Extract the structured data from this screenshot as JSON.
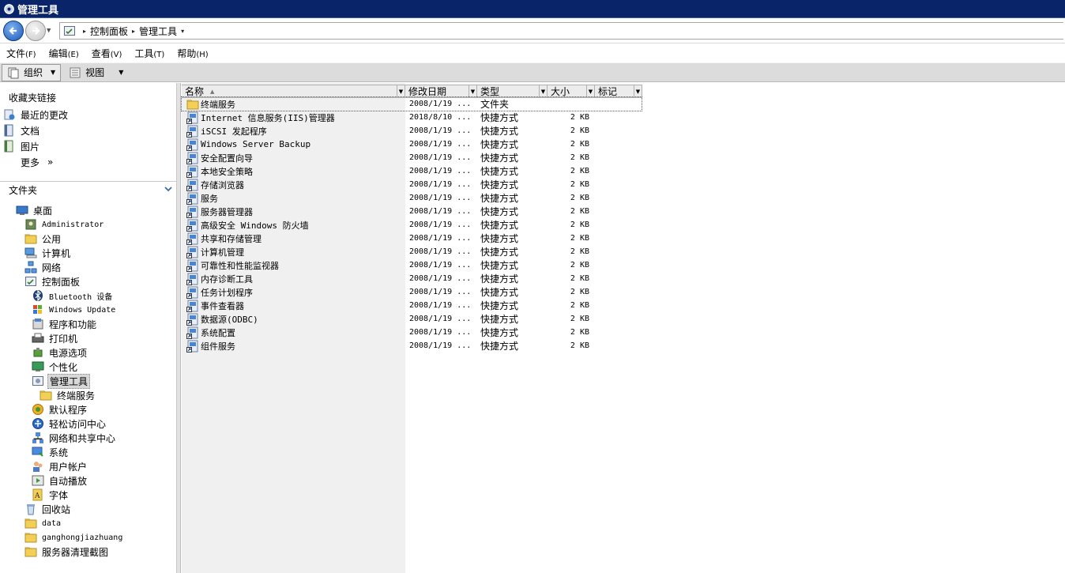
{
  "window": {
    "title": "管理工具"
  },
  "address": {
    "crumbs": [
      "控制面板",
      "管理工具"
    ]
  },
  "menu": [
    {
      "label": "文件",
      "key": "(F)"
    },
    {
      "label": "编辑",
      "key": "(E)"
    },
    {
      "label": "查看",
      "key": "(V)"
    },
    {
      "label": "工具",
      "key": "(T)"
    },
    {
      "label": "帮助",
      "key": "(H)"
    }
  ],
  "toolbar": {
    "organize": "组织",
    "views": "视图"
  },
  "favorites": {
    "header": "收藏夹链接",
    "items": [
      {
        "label": "最近的更改",
        "icon": "recent-icon"
      },
      {
        "label": "文档",
        "icon": "documents-icon"
      },
      {
        "label": "图片",
        "icon": "pictures-icon"
      },
      {
        "label": "更多",
        "icon": "more-icon",
        "suffix": "»"
      }
    ]
  },
  "folders": {
    "header": "文件夹",
    "tree": [
      {
        "label": "桌面",
        "icon": "desktop-icon",
        "level": 0
      },
      {
        "label": "Administrator",
        "icon": "user-folder-icon",
        "level": 1,
        "mono": true
      },
      {
        "label": "公用",
        "icon": "folder-icon",
        "level": 1
      },
      {
        "label": "计算机",
        "icon": "computer-icon",
        "level": 1
      },
      {
        "label": "网络",
        "icon": "network-icon",
        "level": 1
      },
      {
        "label": "控制面板",
        "icon": "control-panel-icon",
        "level": 1
      },
      {
        "label": "Bluetooth 设备",
        "icon": "bluetooth-icon",
        "level": 2,
        "mono": true
      },
      {
        "label": "Windows Update",
        "icon": "windows-update-icon",
        "level": 2,
        "mono": true
      },
      {
        "label": "程序和功能",
        "icon": "programs-icon",
        "level": 2
      },
      {
        "label": "打印机",
        "icon": "printer-icon",
        "level": 2
      },
      {
        "label": "电源选项",
        "icon": "power-icon",
        "level": 2
      },
      {
        "label": "个性化",
        "icon": "personalize-icon",
        "level": 2
      },
      {
        "label": "管理工具",
        "icon": "admin-tools-icon",
        "level": 2,
        "selected": true
      },
      {
        "label": "终端服务",
        "icon": "folder-icon",
        "level": 3
      },
      {
        "label": "默认程序",
        "icon": "default-programs-icon",
        "level": 2
      },
      {
        "label": "轻松访问中心",
        "icon": "ease-of-access-icon",
        "level": 2
      },
      {
        "label": "网络和共享中心",
        "icon": "network-center-icon",
        "level": 2
      },
      {
        "label": "系统",
        "icon": "system-icon",
        "level": 2
      },
      {
        "label": "用户帐户",
        "icon": "users-icon",
        "level": 2
      },
      {
        "label": "自动播放",
        "icon": "autoplay-icon",
        "level": 2
      },
      {
        "label": "字体",
        "icon": "fonts-icon",
        "level": 2
      },
      {
        "label": "回收站",
        "icon": "recycle-bin-icon",
        "level": 1
      },
      {
        "label": "data",
        "icon": "folder-icon",
        "level": 1,
        "mono": true
      },
      {
        "label": "ganghongjiazhuang",
        "icon": "folder-icon",
        "level": 1,
        "mono": true
      },
      {
        "label": "服务器清理截图",
        "icon": "folder-icon",
        "level": 1
      }
    ]
  },
  "columns": [
    "名称",
    "修改日期",
    "类型",
    "大小",
    "标记"
  ],
  "files": [
    {
      "name": "终端服务",
      "date": "2008/1/19 ...",
      "type": "文件夹",
      "size": "",
      "icon": "folder-icon"
    },
    {
      "name": "Internet 信息服务(IIS)管理器",
      "date": "2018/8/10 ...",
      "type": "快捷方式",
      "size": "2 KB",
      "icon": "iis-shortcut-icon"
    },
    {
      "name": "iSCSI 发起程序",
      "date": "2008/1/19 ...",
      "type": "快捷方式",
      "size": "2 KB",
      "icon": "iscsi-shortcut-icon"
    },
    {
      "name": "Windows Server Backup",
      "date": "2008/1/19 ...",
      "type": "快捷方式",
      "size": "2 KB",
      "icon": "backup-shortcut-icon"
    },
    {
      "name": "安全配置向导",
      "date": "2008/1/19 ...",
      "type": "快捷方式",
      "size": "2 KB",
      "icon": "security-wizard-shortcut-icon"
    },
    {
      "name": "本地安全策略",
      "date": "2008/1/19 ...",
      "type": "快捷方式",
      "size": "2 KB",
      "icon": "security-policy-shortcut-icon"
    },
    {
      "name": "存储浏览器",
      "date": "2008/1/19 ...",
      "type": "快捷方式",
      "size": "2 KB",
      "icon": "storage-shortcut-icon"
    },
    {
      "name": "服务",
      "date": "2008/1/19 ...",
      "type": "快捷方式",
      "size": "2 KB",
      "icon": "services-shortcut-icon"
    },
    {
      "name": "服务器管理器",
      "date": "2008/1/19 ...",
      "type": "快捷方式",
      "size": "2 KB",
      "icon": "server-manager-shortcut-icon"
    },
    {
      "name": "高级安全 Windows 防火墙",
      "date": "2008/1/19 ...",
      "type": "快捷方式",
      "size": "2 KB",
      "icon": "firewall-shortcut-icon"
    },
    {
      "name": "共享和存储管理",
      "date": "2008/1/19 ...",
      "type": "快捷方式",
      "size": "2 KB",
      "icon": "share-storage-shortcut-icon"
    },
    {
      "name": "计算机管理",
      "date": "2008/1/19 ...",
      "type": "快捷方式",
      "size": "2 KB",
      "icon": "computer-management-shortcut-icon"
    },
    {
      "name": "可靠性和性能监视器",
      "date": "2008/1/19 ...",
      "type": "快捷方式",
      "size": "2 KB",
      "icon": "perfmon-shortcut-icon"
    },
    {
      "name": "内存诊断工具",
      "date": "2008/1/19 ...",
      "type": "快捷方式",
      "size": "2 KB",
      "icon": "memory-diag-shortcut-icon"
    },
    {
      "name": "任务计划程序",
      "date": "2008/1/19 ...",
      "type": "快捷方式",
      "size": "2 KB",
      "icon": "task-scheduler-shortcut-icon"
    },
    {
      "name": "事件查看器",
      "date": "2008/1/19 ...",
      "type": "快捷方式",
      "size": "2 KB",
      "icon": "event-viewer-shortcut-icon"
    },
    {
      "name": "数据源(ODBC)",
      "date": "2008/1/19 ...",
      "type": "快捷方式",
      "size": "2 KB",
      "icon": "odbc-shortcut-icon"
    },
    {
      "name": "系统配置",
      "date": "2008/1/19 ...",
      "type": "快捷方式",
      "size": "2 KB",
      "icon": "msconfig-shortcut-icon"
    },
    {
      "name": "组件服务",
      "date": "2008/1/19 ...",
      "type": "快捷方式",
      "size": "2 KB",
      "icon": "component-services-shortcut-icon"
    }
  ]
}
